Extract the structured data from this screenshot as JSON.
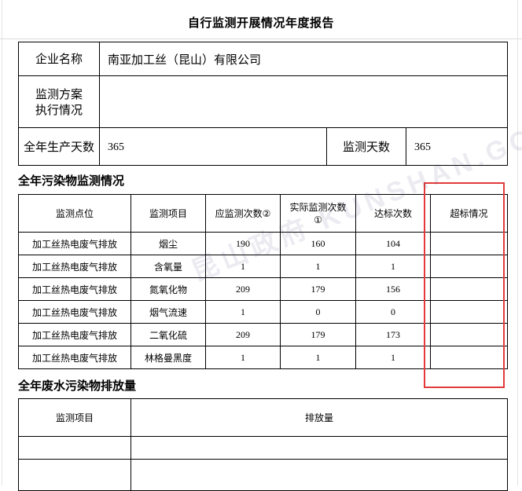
{
  "title": "自行监测开展情况年度报告",
  "info": {
    "company_label": "企业名称",
    "company_value": "南亚加工丝（昆山）有限公司",
    "plan_label_line1": "监测方案",
    "plan_label_line2": "执行情况",
    "plan_value": "",
    "production_days_label": "全年生产天数",
    "production_days_value": "365",
    "monitoring_days_label": "监测天数",
    "monitoring_days_value": "365"
  },
  "pollutant_section": {
    "title": "全年污染物监测情况",
    "headers": {
      "point": "监测点位",
      "item": "监测项目",
      "planned_line1": "应监测次数②",
      "actual_line1": "实际监测次数",
      "actual_line2": "①",
      "compliant": "达标次数",
      "exceed": "超标情况"
    },
    "rows": [
      {
        "point": "加工丝热电废气排放",
        "item": "烟尘",
        "planned": "190",
        "actual": "160",
        "compliant": "104",
        "exceed": ""
      },
      {
        "point": "加工丝热电废气排放",
        "item": "含氧量",
        "planned": "1",
        "actual": "1",
        "compliant": "1",
        "exceed": ""
      },
      {
        "point": "加工丝热电废气排放",
        "item": "氮氧化物",
        "planned": "209",
        "actual": "179",
        "compliant": "156",
        "exceed": ""
      },
      {
        "point": "加工丝热电废气排放",
        "item": "烟气流速",
        "planned": "1",
        "actual": "0",
        "compliant": "0",
        "exceed": ""
      },
      {
        "point": "加工丝热电废气排放",
        "item": "二氧化硫",
        "planned": "209",
        "actual": "179",
        "compliant": "173",
        "exceed": ""
      },
      {
        "point": "加工丝热电废气排放",
        "item": "林格曼黑度",
        "planned": "1",
        "actual": "1",
        "compliant": "1",
        "exceed": ""
      }
    ]
  },
  "wastewater_section": {
    "title": "全年废水污染物排放量",
    "headers": {
      "item": "监测项目",
      "emission": "排放量"
    }
  },
  "watermark": "昆山政府 KUNSHAN.GOV.CN",
  "highlight_color": "#e23a3a"
}
